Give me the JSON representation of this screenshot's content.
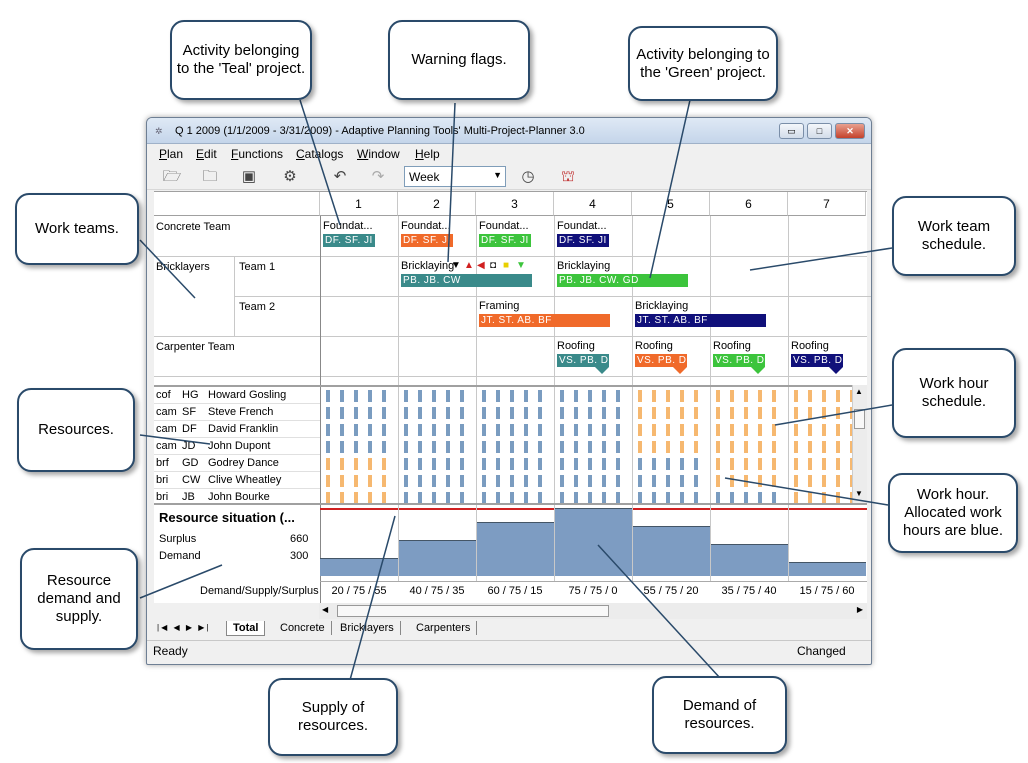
{
  "window": {
    "title": "Q 1 2009 (1/1/2009 - 3/31/2009) - Adaptive Planning Tools' Multi-Project-Planner 3.0",
    "min": "▭",
    "max": "□",
    "close": "✕"
  },
  "menu": [
    "Plan",
    "Edit",
    "Functions",
    "Catalogs",
    "Window",
    "Help"
  ],
  "toolbar": {
    "period": "Week"
  },
  "columns": [
    "1",
    "2",
    "3",
    "4",
    "5",
    "6",
    "7"
  ],
  "teams": {
    "concrete": "Concrete Team",
    "bricklayers": "Bricklayers",
    "team1": "Team 1",
    "team2": "Team 2",
    "carpenter": "Carpenter Team"
  },
  "activities": [
    {
      "name": "Foundat...",
      "crew": "DF. SF. JI",
      "color": "#3a8a8a"
    },
    {
      "name": "Foundat...",
      "crew": "DF. SF. JI",
      "color": "#f06a2a"
    },
    {
      "name": "Foundat...",
      "crew": "DF. SF. JI",
      "color": "#3cc43c"
    },
    {
      "name": "Foundat...",
      "crew": "DF. SF. JI",
      "color": "#10107a"
    },
    {
      "name": "Bricklaying",
      "crew": "PB. JB. CW",
      "color": "#3a8a8a"
    },
    {
      "name": "Bricklaying",
      "crew": "PB. JB. CW. GD",
      "color": "#3cc43c"
    },
    {
      "name": "Framing",
      "crew": "JT. ST. AB. BF",
      "color": "#f06a2a"
    },
    {
      "name": "Bricklaying",
      "crew": "JT. ST. AB. BF",
      "color": "#10107a"
    },
    {
      "name": "Roofing",
      "crew": "VS. PB. D",
      "color": "#3a8a8a"
    },
    {
      "name": "Roofing",
      "crew": "VS. PB. D",
      "color": "#f06a2a"
    },
    {
      "name": "Roofing",
      "crew": "VS. PB. D",
      "color": "#3cc43c"
    },
    {
      "name": "Roofing",
      "crew": "VS. PB. D",
      "color": "#10107a"
    }
  ],
  "resources": [
    {
      "code": "cof",
      "init": "HG",
      "name": "Howard Gosling"
    },
    {
      "code": "cam",
      "init": "SF",
      "name": "Steve French"
    },
    {
      "code": "cam",
      "init": "DF",
      "name": "David Franklin"
    },
    {
      "code": "cam",
      "init": "JD",
      "name": "John Dupont"
    },
    {
      "code": "brf",
      "init": "GD",
      "name": "Godrey Dance"
    },
    {
      "code": "bri",
      "init": "CW",
      "name": "Clive Wheatley"
    },
    {
      "code": "bri",
      "init": "JB",
      "name": "John Bourke"
    }
  ],
  "situation": {
    "title": "Resource situation (...",
    "surplus_label": "Surplus",
    "surplus": "660",
    "demand_label": "Demand",
    "demand": "300",
    "footer_label": "Demand/Supply/Surplus",
    "cells": [
      "20 / 75 / 55",
      "40 / 75 / 35",
      "60 / 75 / 15",
      "75 / 75 / 0",
      "55 / 75 / 20",
      "35 / 75 / 40",
      "15 / 75 / 60"
    ],
    "demand_values": [
      20,
      40,
      60,
      75,
      55,
      35,
      15
    ],
    "supply": 75
  },
  "tabs": [
    "Total",
    "Concrete",
    "Bricklayers",
    "Carpenters"
  ],
  "status": {
    "ready": "Ready",
    "changed": "Changed"
  },
  "callouts": {
    "teal": "Activity belonging to the 'Teal' project.",
    "warning": "Warning flags.",
    "green": "Activity belonging to the 'Green' project.",
    "teams": "Work teams.",
    "schedule": "Work team schedule.",
    "resources": "Resources.",
    "hours": "Work hour schedule.",
    "blue": "Work hour. Allocated work hours are blue.",
    "demandsupply": "Resource demand and supply.",
    "supplyof": "Supply of resources.",
    "demandof": "Demand of resources."
  },
  "colors": {
    "blue": "#7a9cc0",
    "orange": "#f6b870",
    "red": "#d02020"
  }
}
